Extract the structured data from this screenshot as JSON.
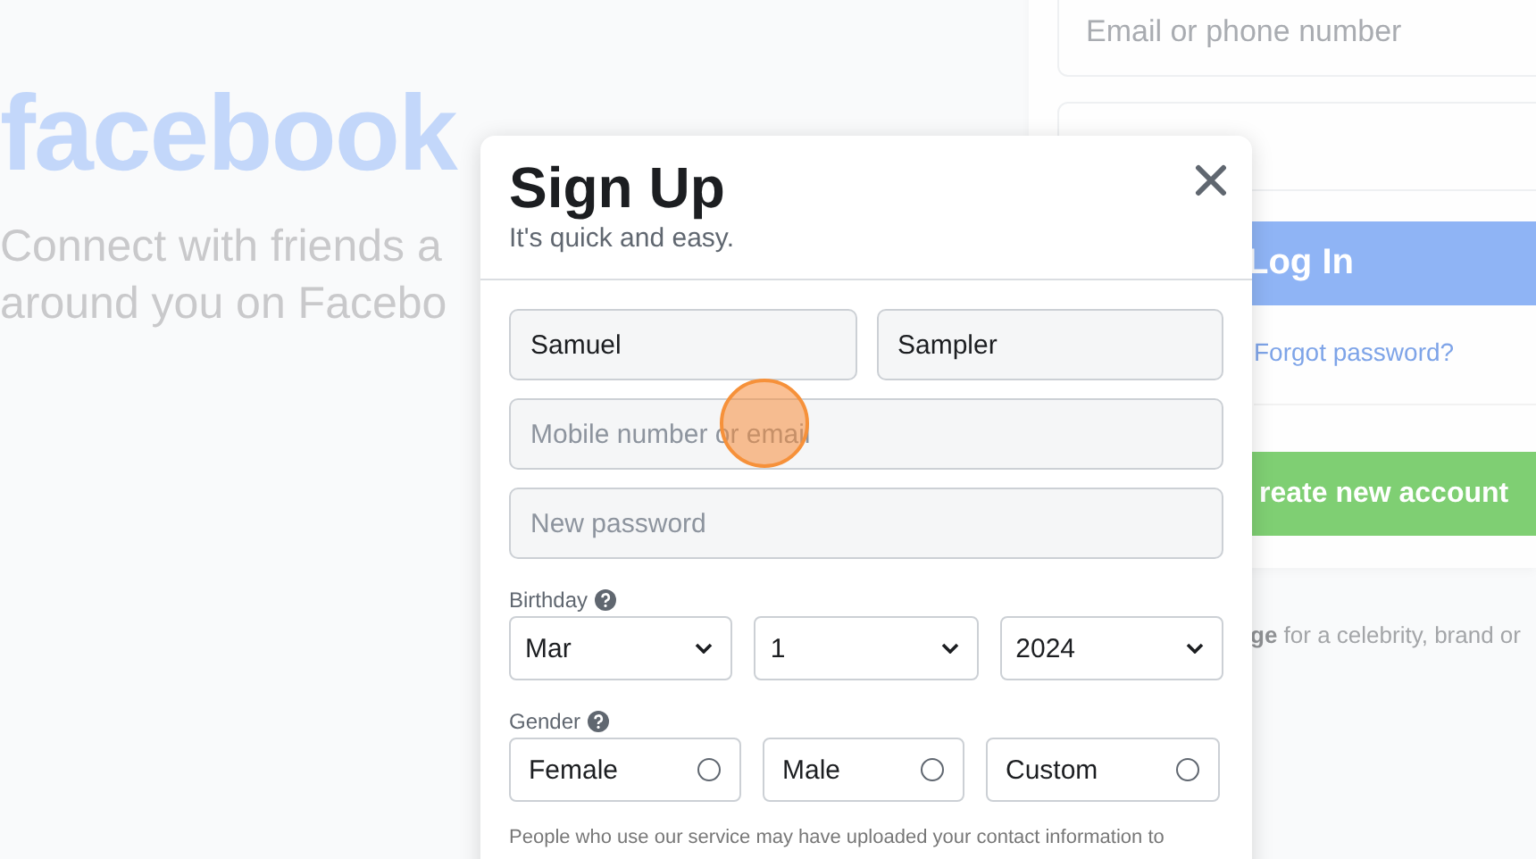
{
  "background": {
    "logo": "facebook",
    "tagline_lines": [
      "Connect with friends a",
      "around you on Facebo"
    ],
    "login_card": {
      "email_placeholder": "Email or phone number",
      "login_button": "Log In",
      "forgot_link": "Forgot password?",
      "create_button": "reate new account"
    },
    "page_note": "**ge** for a celebrity, brand or"
  },
  "dialog": {
    "title": "Sign Up",
    "subtitle": "It's quick and easy.",
    "fields": [
      {
        "value": "Samuel"
      },
      {
        "value": "Sampler"
      },
      {
        "placeholder": "Mobile number or email"
      },
      {
        "placeholder": "New password"
      }
    ],
    "birthday_label": "Birthday",
    "birthday": [
      "Mar",
      "1",
      "2024"
    ],
    "gender_label": "Gender",
    "genders": [
      {
        "label": "Female",
        "selected": false
      },
      {
        "label": "Male",
        "selected": false
      },
      {
        "label": "Custom",
        "selected": false
      }
    ],
    "note": "People who use our service may have uploaded your contact information to"
  }
}
